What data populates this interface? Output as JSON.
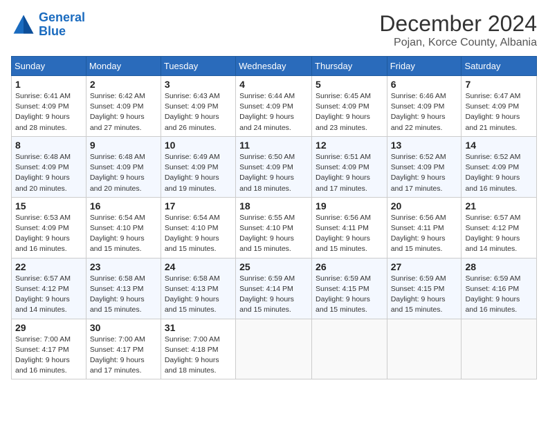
{
  "logo": {
    "line1": "General",
    "line2": "Blue"
  },
  "header": {
    "month": "December 2024",
    "location": "Pojan, Korce County, Albania"
  },
  "weekdays": [
    "Sunday",
    "Monday",
    "Tuesday",
    "Wednesday",
    "Thursday",
    "Friday",
    "Saturday"
  ],
  "weeks": [
    [
      {
        "day": "1",
        "sunrise": "Sunrise: 6:41 AM",
        "sunset": "Sunset: 4:09 PM",
        "daylight": "Daylight: 9 hours and 28 minutes."
      },
      {
        "day": "2",
        "sunrise": "Sunrise: 6:42 AM",
        "sunset": "Sunset: 4:09 PM",
        "daylight": "Daylight: 9 hours and 27 minutes."
      },
      {
        "day": "3",
        "sunrise": "Sunrise: 6:43 AM",
        "sunset": "Sunset: 4:09 PM",
        "daylight": "Daylight: 9 hours and 26 minutes."
      },
      {
        "day": "4",
        "sunrise": "Sunrise: 6:44 AM",
        "sunset": "Sunset: 4:09 PM",
        "daylight": "Daylight: 9 hours and 24 minutes."
      },
      {
        "day": "5",
        "sunrise": "Sunrise: 6:45 AM",
        "sunset": "Sunset: 4:09 PM",
        "daylight": "Daylight: 9 hours and 23 minutes."
      },
      {
        "day": "6",
        "sunrise": "Sunrise: 6:46 AM",
        "sunset": "Sunset: 4:09 PM",
        "daylight": "Daylight: 9 hours and 22 minutes."
      },
      {
        "day": "7",
        "sunrise": "Sunrise: 6:47 AM",
        "sunset": "Sunset: 4:09 PM",
        "daylight": "Daylight: 9 hours and 21 minutes."
      }
    ],
    [
      {
        "day": "8",
        "sunrise": "Sunrise: 6:48 AM",
        "sunset": "Sunset: 4:09 PM",
        "daylight": "Daylight: 9 hours and 20 minutes."
      },
      {
        "day": "9",
        "sunrise": "Sunrise: 6:48 AM",
        "sunset": "Sunset: 4:09 PM",
        "daylight": "Daylight: 9 hours and 20 minutes."
      },
      {
        "day": "10",
        "sunrise": "Sunrise: 6:49 AM",
        "sunset": "Sunset: 4:09 PM",
        "daylight": "Daylight: 9 hours and 19 minutes."
      },
      {
        "day": "11",
        "sunrise": "Sunrise: 6:50 AM",
        "sunset": "Sunset: 4:09 PM",
        "daylight": "Daylight: 9 hours and 18 minutes."
      },
      {
        "day": "12",
        "sunrise": "Sunrise: 6:51 AM",
        "sunset": "Sunset: 4:09 PM",
        "daylight": "Daylight: 9 hours and 17 minutes."
      },
      {
        "day": "13",
        "sunrise": "Sunrise: 6:52 AM",
        "sunset": "Sunset: 4:09 PM",
        "daylight": "Daylight: 9 hours and 17 minutes."
      },
      {
        "day": "14",
        "sunrise": "Sunrise: 6:52 AM",
        "sunset": "Sunset: 4:09 PM",
        "daylight": "Daylight: 9 hours and 16 minutes."
      }
    ],
    [
      {
        "day": "15",
        "sunrise": "Sunrise: 6:53 AM",
        "sunset": "Sunset: 4:09 PM",
        "daylight": "Daylight: 9 hours and 16 minutes."
      },
      {
        "day": "16",
        "sunrise": "Sunrise: 6:54 AM",
        "sunset": "Sunset: 4:10 PM",
        "daylight": "Daylight: 9 hours and 15 minutes."
      },
      {
        "day": "17",
        "sunrise": "Sunrise: 6:54 AM",
        "sunset": "Sunset: 4:10 PM",
        "daylight": "Daylight: 9 hours and 15 minutes."
      },
      {
        "day": "18",
        "sunrise": "Sunrise: 6:55 AM",
        "sunset": "Sunset: 4:10 PM",
        "daylight": "Daylight: 9 hours and 15 minutes."
      },
      {
        "day": "19",
        "sunrise": "Sunrise: 6:56 AM",
        "sunset": "Sunset: 4:11 PM",
        "daylight": "Daylight: 9 hours and 15 minutes."
      },
      {
        "day": "20",
        "sunrise": "Sunrise: 6:56 AM",
        "sunset": "Sunset: 4:11 PM",
        "daylight": "Daylight: 9 hours and 15 minutes."
      },
      {
        "day": "21",
        "sunrise": "Sunrise: 6:57 AM",
        "sunset": "Sunset: 4:12 PM",
        "daylight": "Daylight: 9 hours and 14 minutes."
      }
    ],
    [
      {
        "day": "22",
        "sunrise": "Sunrise: 6:57 AM",
        "sunset": "Sunset: 4:12 PM",
        "daylight": "Daylight: 9 hours and 14 minutes."
      },
      {
        "day": "23",
        "sunrise": "Sunrise: 6:58 AM",
        "sunset": "Sunset: 4:13 PM",
        "daylight": "Daylight: 9 hours and 15 minutes."
      },
      {
        "day": "24",
        "sunrise": "Sunrise: 6:58 AM",
        "sunset": "Sunset: 4:13 PM",
        "daylight": "Daylight: 9 hours and 15 minutes."
      },
      {
        "day": "25",
        "sunrise": "Sunrise: 6:59 AM",
        "sunset": "Sunset: 4:14 PM",
        "daylight": "Daylight: 9 hours and 15 minutes."
      },
      {
        "day": "26",
        "sunrise": "Sunrise: 6:59 AM",
        "sunset": "Sunset: 4:15 PM",
        "daylight": "Daylight: 9 hours and 15 minutes."
      },
      {
        "day": "27",
        "sunrise": "Sunrise: 6:59 AM",
        "sunset": "Sunset: 4:15 PM",
        "daylight": "Daylight: 9 hours and 15 minutes."
      },
      {
        "day": "28",
        "sunrise": "Sunrise: 6:59 AM",
        "sunset": "Sunset: 4:16 PM",
        "daylight": "Daylight: 9 hours and 16 minutes."
      }
    ],
    [
      {
        "day": "29",
        "sunrise": "Sunrise: 7:00 AM",
        "sunset": "Sunset: 4:17 PM",
        "daylight": "Daylight: 9 hours and 16 minutes."
      },
      {
        "day": "30",
        "sunrise": "Sunrise: 7:00 AM",
        "sunset": "Sunset: 4:17 PM",
        "daylight": "Daylight: 9 hours and 17 minutes."
      },
      {
        "day": "31",
        "sunrise": "Sunrise: 7:00 AM",
        "sunset": "Sunset: 4:18 PM",
        "daylight": "Daylight: 9 hours and 18 minutes."
      },
      null,
      null,
      null,
      null
    ]
  ]
}
